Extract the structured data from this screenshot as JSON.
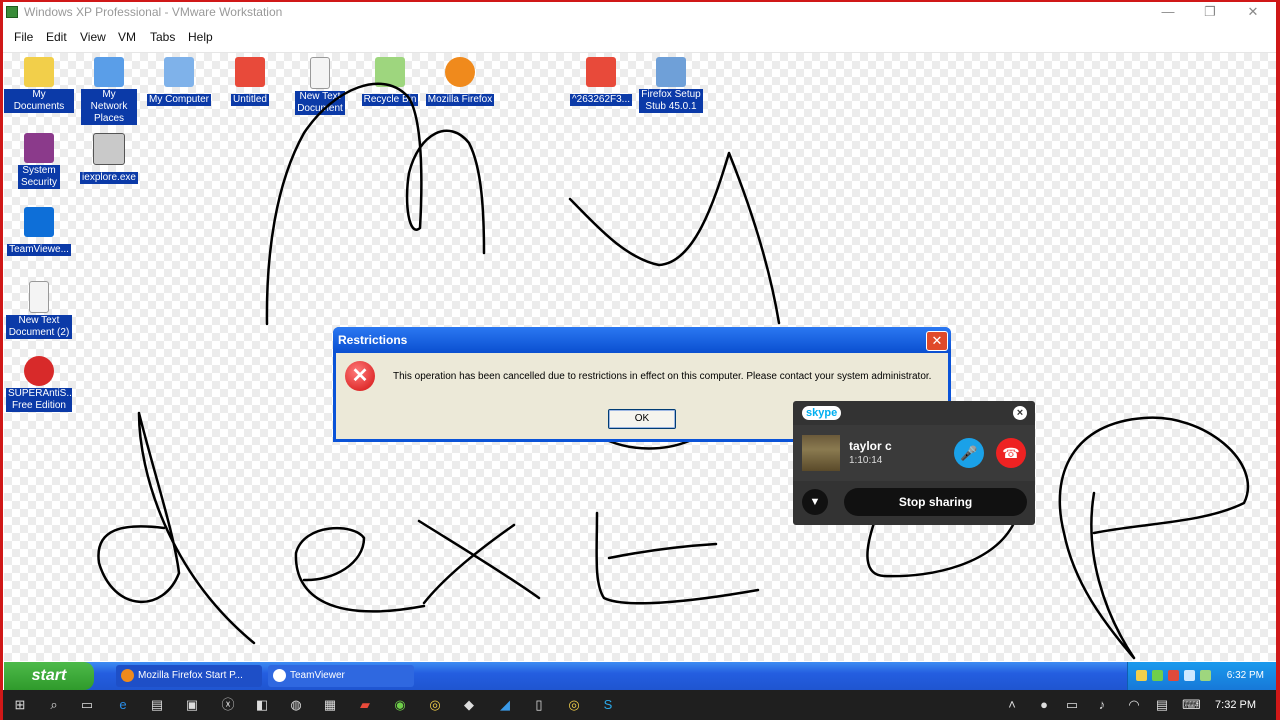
{
  "vm": {
    "title": "Windows XP Professional - VMware Workstation",
    "menu": [
      "File",
      "Edit",
      "View",
      "VM",
      "Tabs",
      "Help"
    ]
  },
  "desktop_icons": [
    {
      "label": "My Documents",
      "icon": "folder-icon",
      "color": "#f2cf4a"
    },
    {
      "label": "My Network Places",
      "icon": "network-icon",
      "color": "#5a9ee8"
    },
    {
      "label": "My Computer",
      "icon": "computer-icon",
      "color": "#7fb2ea"
    },
    {
      "label": "Untitled",
      "icon": "paint-icon",
      "color": "#e84a3a"
    },
    {
      "label": "New Text Document",
      "icon": "text-file-icon",
      "color": "#f4f4f4"
    },
    {
      "label": "Recycle Bin",
      "icon": "recycle-bin-icon",
      "color": "#9ed67e"
    },
    {
      "label": "Mozilla Firefox",
      "icon": "firefox-icon",
      "color": "#f08a1c"
    },
    {
      "label": "^263262F3...",
      "icon": "paint-icon",
      "color": "#e84a3a"
    },
    {
      "label": "Firefox Setup Stub 45.0.1",
      "icon": "installer-icon",
      "color": "#6fa0d8"
    },
    {
      "label": "System Security",
      "icon": "winrar-icon",
      "color": "#8b3a8b"
    },
    {
      "label": "iexplore.exe",
      "icon": "exe-icon",
      "color": "#c9c9c9"
    },
    {
      "label": "TeamViewe...",
      "icon": "teamviewer-icon",
      "color": "#0e6fd8"
    },
    {
      "label": "New Text Document (2)",
      "icon": "text-file-icon",
      "color": "#f4f4f4"
    },
    {
      "label": "SUPERAntiS... Free Edition",
      "icon": "superantispyware-icon",
      "color": "#d82a2a"
    }
  ],
  "dialog": {
    "title": "Restrictions",
    "message": "This operation has been cancelled due to restrictions in effect on this computer. Please contact your system administrator.",
    "ok": "OK",
    "close": "✕"
  },
  "skype": {
    "logo": "skype",
    "caller": "taylor c",
    "duration": "1:10:14",
    "stop_sharing": "Stop sharing"
  },
  "xp_taskbar": {
    "start": "start",
    "tasks": [
      "Mozilla Firefox Start P...",
      "TeamViewer"
    ],
    "clock": "6:32 PM"
  },
  "host_taskbar": {
    "clock": "7:32 PM"
  }
}
